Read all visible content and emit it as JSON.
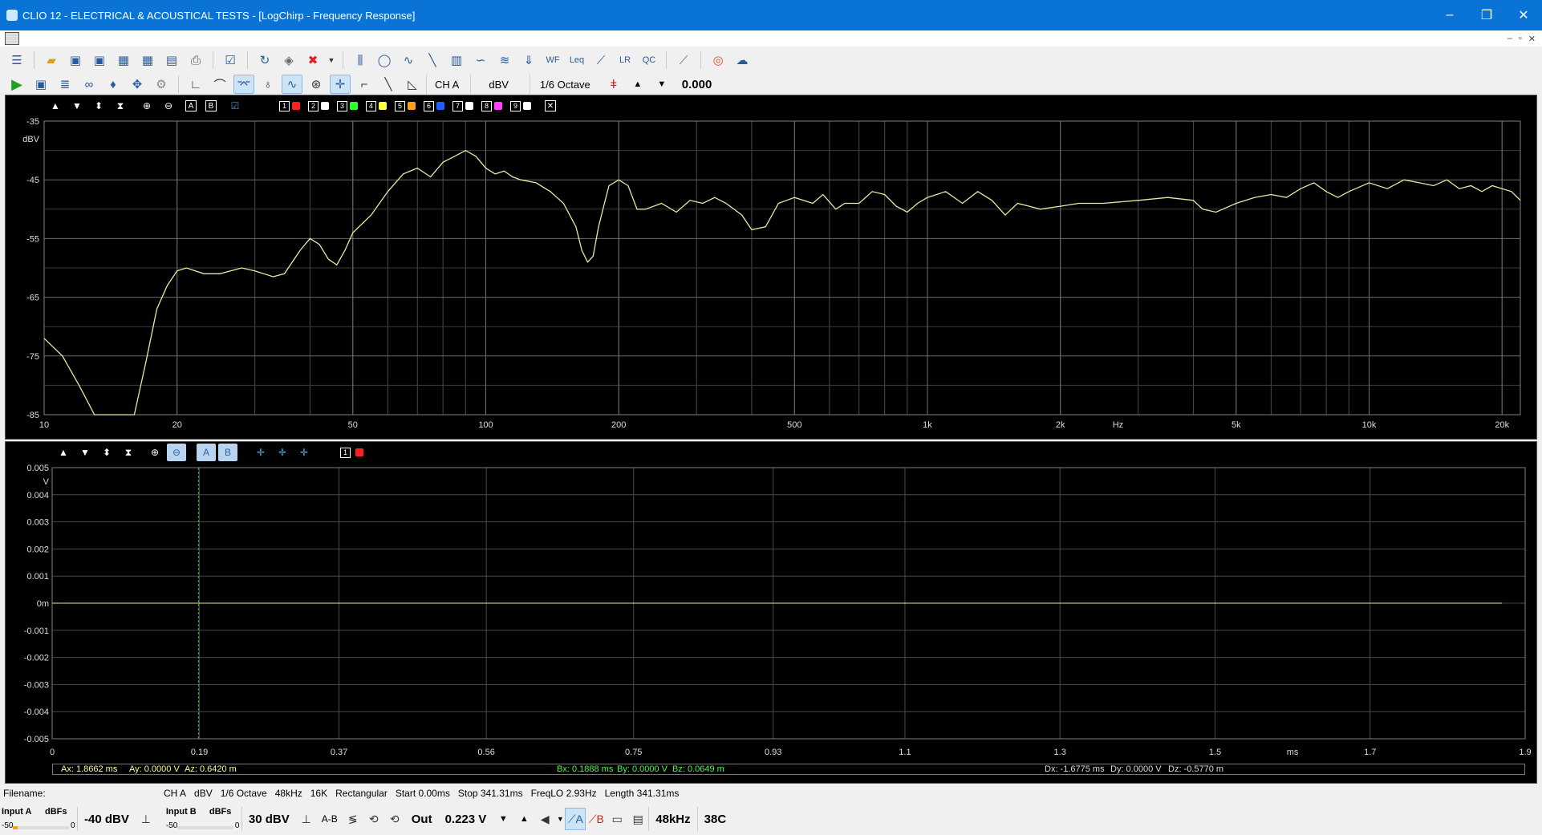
{
  "window": {
    "title": "CLIO 12 - ELECTRICAL & ACOUSTICAL TESTS - [LogChirp - Frequency Response]",
    "controls": [
      "–",
      "❐",
      "✕"
    ]
  },
  "mdi": {
    "controls": [
      "–",
      "▫",
      "✕"
    ]
  },
  "toolbar1": {
    "icons": [
      "menu-icon",
      "open-folder-icon",
      "save-icon",
      "save-as-icon",
      "export-icon",
      "export-image-icon",
      "calendar-icon",
      "print-icon",
      "check-icon",
      "refresh-icon",
      "erase-icon",
      "delete-icon",
      "dropdown-arrow-icon",
      "mls-icon",
      "sinusoid-icon",
      "waveform-icon",
      "sweep-icon",
      "fft-icon",
      "wave-icon",
      "waterfall-icon",
      "impedance-icon",
      "wf-icon",
      "leq-icon",
      "tube-icon",
      "lr-icon",
      "qc-icon",
      "ruler-icon",
      "help-lifebuoy-icon",
      "web-help-icon"
    ]
  },
  "toolbar2": {
    "channel": "CH A",
    "unit": "dBV",
    "smoothing": "1/6 Octave",
    "value": "0.000"
  },
  "top_panel": {
    "memory_slots": [
      "1",
      "2",
      "3",
      "4",
      "5",
      "6",
      "7",
      "8",
      "9"
    ],
    "memory_colors": [
      "#ff2020",
      "#ffffff",
      "#30ff30",
      "#ffff40",
      "#ffa020",
      "#2060ff",
      "#ffffff",
      "#ff40ff",
      "#ffffff"
    ],
    "close_glyph": "✕",
    "buttons": [
      "A",
      "B"
    ]
  },
  "bottom_panel": {
    "buttons": [
      "A",
      "B"
    ],
    "memory_slot": "1"
  },
  "chart_data": [
    {
      "type": "line",
      "title": "",
      "xlabel": "Hz",
      "ylabel": "dBV",
      "x_scale": "log",
      "xlim": [
        10,
        22000
      ],
      "ylim": [
        -85,
        -35
      ],
      "y_ticks": [
        "-35",
        "-45",
        "-55",
        "-65",
        "-75",
        "-85"
      ],
      "x_ticks": [
        {
          "v": 10,
          "label": "10"
        },
        {
          "v": 20,
          "label": "20"
        },
        {
          "v": 50,
          "label": "50"
        },
        {
          "v": 100,
          "label": "100"
        },
        {
          "v": 200,
          "label": "200"
        },
        {
          "v": 500,
          "label": "500"
        },
        {
          "v": 1000,
          "label": "1k"
        },
        {
          "v": 2000,
          "label": "2k"
        },
        {
          "v": 5000,
          "label": "5k"
        },
        {
          "v": 10000,
          "label": "10k"
        },
        {
          "v": 20000,
          "label": "20k"
        }
      ],
      "grid": true,
      "series": [
        {
          "color": "#e8e8a0",
          "points": [
            [
              10,
              -72
            ],
            [
              11,
              -75
            ],
            [
              12,
              -80
            ],
            [
              13,
              -85
            ],
            [
              15,
              -85
            ],
            [
              16,
              -85
            ],
            [
              17,
              -76
            ],
            [
              18,
              -67
            ],
            [
              19,
              -63
            ],
            [
              20,
              -60.5
            ],
            [
              21,
              -60
            ],
            [
              23,
              -61
            ],
            [
              25,
              -61
            ],
            [
              28,
              -60
            ],
            [
              30,
              -60.5
            ],
            [
              33,
              -61.5
            ],
            [
              35,
              -61
            ],
            [
              38,
              -57
            ],
            [
              40,
              -55
            ],
            [
              42,
              -56
            ],
            [
              44,
              -58.5
            ],
            [
              46,
              -59.5
            ],
            [
              48,
              -57
            ],
            [
              50,
              -54
            ],
            [
              55,
              -51
            ],
            [
              60,
              -47
            ],
            [
              65,
              -44
            ],
            [
              70,
              -43
            ],
            [
              75,
              -44.5
            ],
            [
              80,
              -42
            ],
            [
              85,
              -41
            ],
            [
              90,
              -40
            ],
            [
              95,
              -41
            ],
            [
              100,
              -43
            ],
            [
              105,
              -44
            ],
            [
              110,
              -43.5
            ],
            [
              115,
              -44.5
            ],
            [
              120,
              -45
            ],
            [
              130,
              -45.5
            ],
            [
              140,
              -47
            ],
            [
              150,
              -49
            ],
            [
              160,
              -53
            ],
            [
              165,
              -57
            ],
            [
              170,
              -59
            ],
            [
              175,
              -58
            ],
            [
              180,
              -53
            ],
            [
              190,
              -46
            ],
            [
              200,
              -45
            ],
            [
              210,
              -46
            ],
            [
              220,
              -50
            ],
            [
              230,
              -50
            ],
            [
              250,
              -49
            ],
            [
              270,
              -50.5
            ],
            [
              290,
              -48.5
            ],
            [
              310,
              -49
            ],
            [
              330,
              -48
            ],
            [
              350,
              -49
            ],
            [
              380,
              -51
            ],
            [
              400,
              -53.5
            ],
            [
              430,
              -53
            ],
            [
              460,
              -49
            ],
            [
              500,
              -48
            ],
            [
              550,
              -49
            ],
            [
              580,
              -47.5
            ],
            [
              620,
              -50
            ],
            [
              650,
              -49
            ],
            [
              700,
              -49
            ],
            [
              750,
              -47
            ],
            [
              800,
              -47.5
            ],
            [
              850,
              -49.5
            ],
            [
              900,
              -50.5
            ],
            [
              950,
              -49
            ],
            [
              1000,
              -48
            ],
            [
              1100,
              -47
            ],
            [
              1200,
              -49
            ],
            [
              1300,
              -47
            ],
            [
              1400,
              -48.5
            ],
            [
              1500,
              -51
            ],
            [
              1600,
              -49
            ],
            [
              1700,
              -49.5
            ],
            [
              1800,
              -50
            ],
            [
              2000,
              -49.5
            ],
            [
              2200,
              -49
            ],
            [
              2500,
              -49
            ],
            [
              3000,
              -48.5
            ],
            [
              3500,
              -48
            ],
            [
              4000,
              -48.5
            ],
            [
              4200,
              -50
            ],
            [
              4500,
              -50.5
            ],
            [
              5000,
              -49
            ],
            [
              5500,
              -48
            ],
            [
              6000,
              -47.5
            ],
            [
              6500,
              -48
            ],
            [
              7000,
              -46.5
            ],
            [
              7500,
              -45.5
            ],
            [
              8000,
              -47
            ],
            [
              8500,
              -48
            ],
            [
              9000,
              -47
            ],
            [
              10000,
              -45.5
            ],
            [
              11000,
              -46.5
            ],
            [
              12000,
              -45
            ],
            [
              13000,
              -45.5
            ],
            [
              14000,
              -46
            ],
            [
              15000,
              -45
            ],
            [
              16000,
              -46.5
            ],
            [
              17000,
              -46
            ],
            [
              18000,
              -47
            ],
            [
              19000,
              -46
            ],
            [
              20000,
              -46.5
            ],
            [
              21000,
              -47
            ],
            [
              22000,
              -48.5
            ]
          ]
        }
      ]
    },
    {
      "type": "line",
      "title": "",
      "xlabel": "ms",
      "ylabel": "V",
      "xlim": [
        0,
        1.9
      ],
      "ylim": [
        -0.005,
        0.005
      ],
      "x_ticks": [
        {
          "v": 0,
          "label": "0"
        },
        {
          "v": 0.19,
          "label": "0.19"
        },
        {
          "v": 0.37,
          "label": "0.37"
        },
        {
          "v": 0.56,
          "label": "0.56"
        },
        {
          "v": 0.75,
          "label": "0.75"
        },
        {
          "v": 0.93,
          "label": "0.93"
        },
        {
          "v": 1.1,
          "label": "1.1"
        },
        {
          "v": 1.3,
          "label": "1.3"
        },
        {
          "v": 1.5,
          "label": "1.5"
        },
        {
          "v": 1.7,
          "label": "1.7"
        },
        {
          "v": 1.9,
          "label": "1.9"
        }
      ],
      "y_ticks": [
        {
          "v": 0.005,
          "label": "0.005"
        },
        {
          "v": 0.004,
          "label": "0.004"
        },
        {
          "v": 0.003,
          "label": "0.003"
        },
        {
          "v": 0.002,
          "label": "0.002"
        },
        {
          "v": 0.001,
          "label": "0.001"
        },
        {
          "v": 0,
          "label": "0m"
        },
        {
          "v": -0.001,
          "label": "-0.001"
        },
        {
          "v": -0.002,
          "label": "-0.002"
        },
        {
          "v": -0.003,
          "label": "-0.003"
        },
        {
          "v": -0.004,
          "label": "-0.004"
        },
        {
          "v": -0.005,
          "label": "-0.005"
        }
      ],
      "grid": true,
      "cursor_x": 0.1888,
      "series": [
        {
          "color": "#e8e8a0",
          "points": [
            [
              0,
              0
            ],
            [
              1.87,
              0
            ]
          ]
        }
      ],
      "cursor_readout": {
        "a": [
          "Ax: 1.8662 ms",
          "Ay: 0.0000 V",
          "Az: 0.6420 m"
        ],
        "b": [
          "Bx: 0.1888 ms",
          "By: 0.0000 V",
          "Bz: 0.0649 m"
        ],
        "d": [
          "Dx: -1.6775 ms",
          "Dy: 0.0000 V",
          "Dz: -0.5770 m"
        ]
      }
    }
  ],
  "status": {
    "filename_label": "Filename:",
    "info": [
      "CH A",
      "dBV",
      "1/6 Octave",
      "48kHz",
      "16K",
      "Rectangular",
      "Start 0.00ms",
      "Stop 341.31ms",
      "FreqLO 2.93Hz",
      "Length 341.31ms"
    ]
  },
  "bottom": {
    "input_a": {
      "label": "Input A",
      "dbfs": "dBFs",
      "min": "-50",
      "max": "0",
      "level": 0.08
    },
    "input_a_range": "-40 dBV",
    "input_b": {
      "label": "Input B",
      "dbfs": "dBFs",
      "min": "-50",
      "max": "0",
      "level": 0
    },
    "input_b_range": "30 dBV",
    "ab_label": "A-B",
    "out_label": "Out",
    "out_level": "0.223 V",
    "sample_rate": "48kHz",
    "temperature": "38C"
  }
}
